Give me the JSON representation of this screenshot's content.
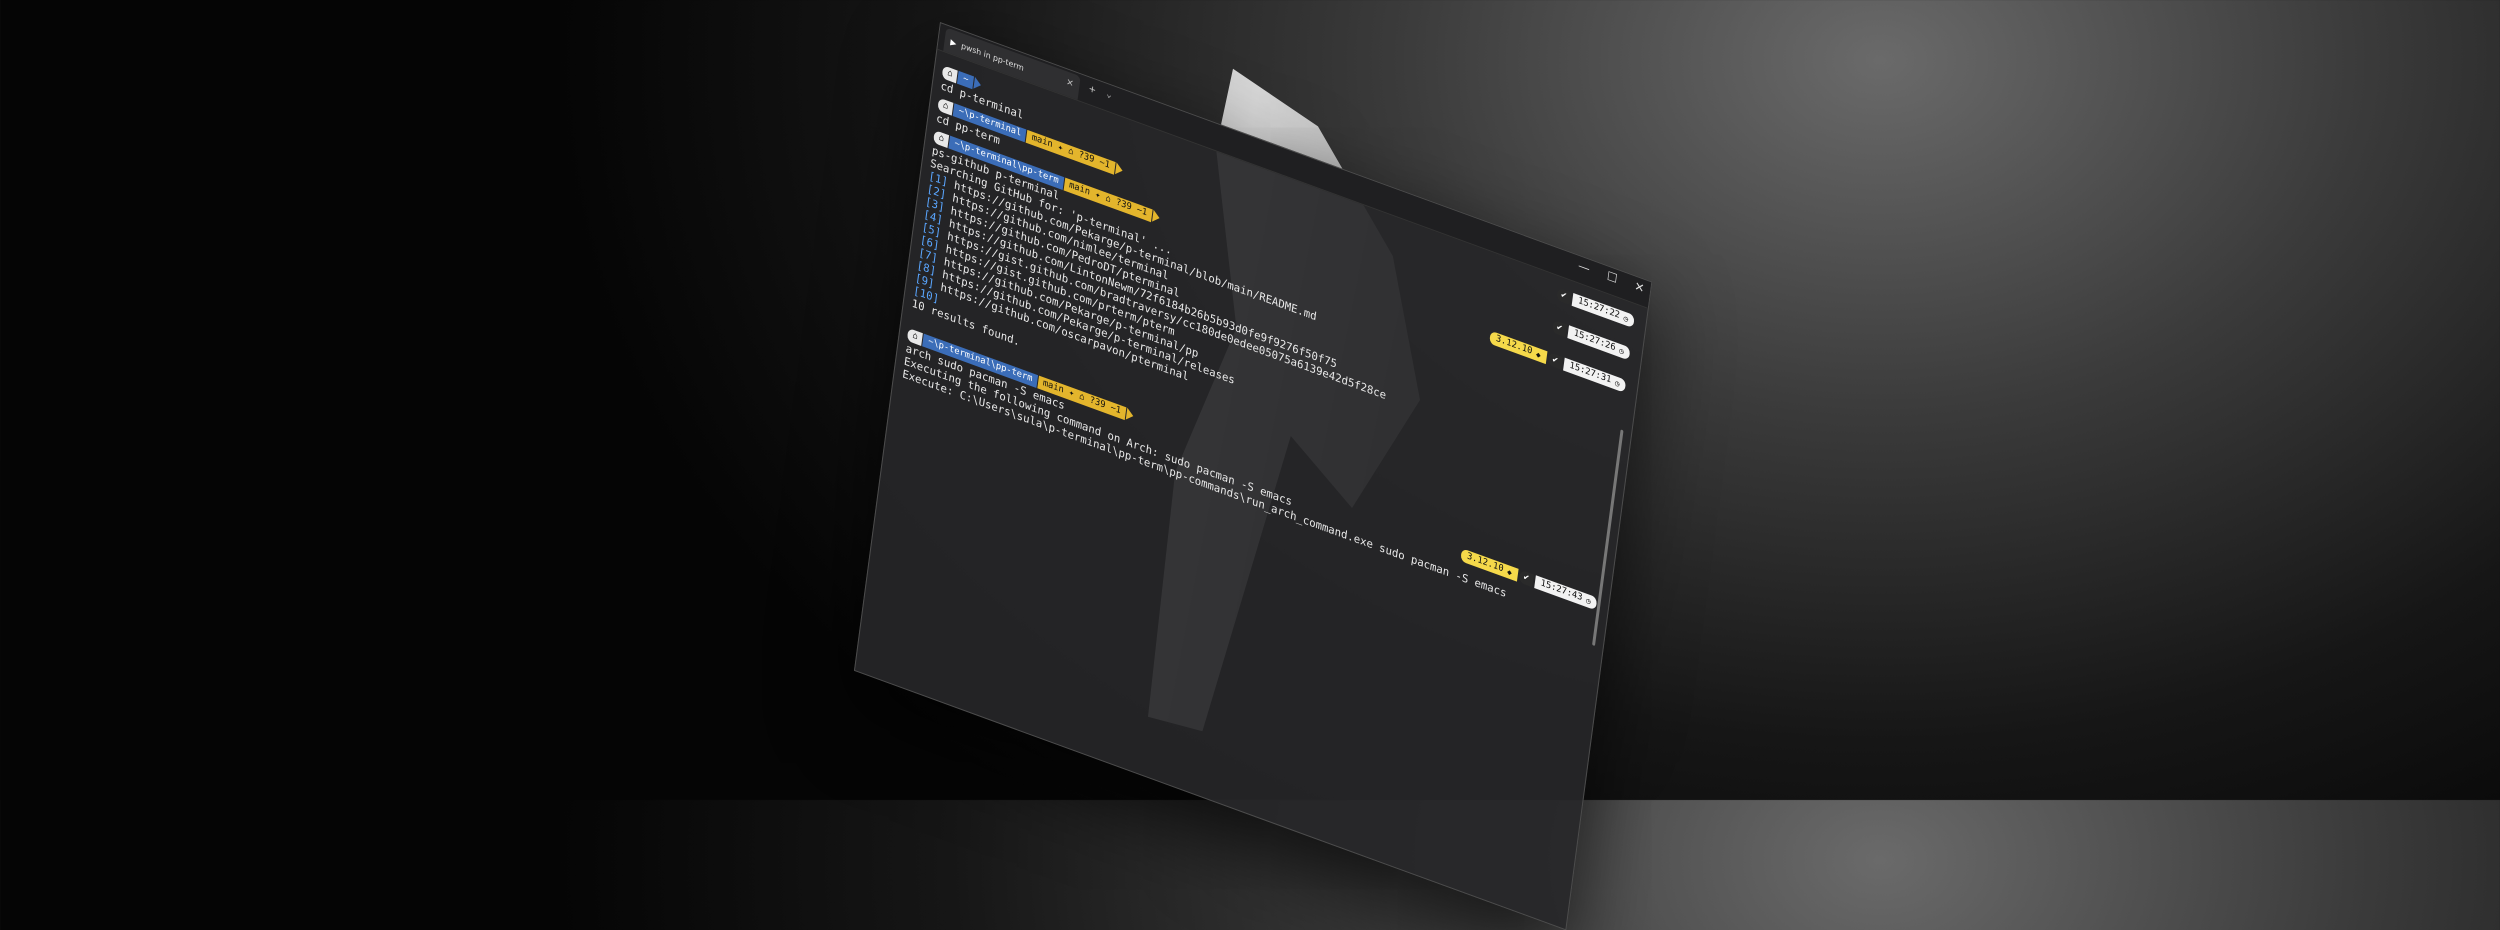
{
  "window": {
    "tab_title": "pwsh in pp-term",
    "tab_icon": "terminal-icon",
    "new_tab": "+",
    "dropdown": "⌄",
    "minimize": "—",
    "maximize": "☐",
    "close": "✕"
  },
  "prompt": {
    "os_icon": "arch-linux-icon",
    "git_branch": "main ✦ ⌂ ?39 ~1",
    "colors": {
      "os": "#e8e8e8",
      "dir": "#3b6db8",
      "git": "#e3b52c",
      "python": "#f5d94a"
    }
  },
  "session": {
    "p1_dir": "~",
    "cmd1": "cd p-terminal",
    "p2_dir": "~\\p-terminal",
    "cmd2": "cd pp-term",
    "p3_dir": "~\\p-terminal\\pp-term",
    "cmd3": "ps-github p-terminal",
    "search_msg": "Searching GitHub for: 'p-terminal' ...",
    "results": [
      {
        "idx": "[1]",
        "url": "https://github.com/Pekarge/p-terminal/blob/main/README.md"
      },
      {
        "idx": "[2]",
        "url": "https://github.com/nimlee/terminal"
      },
      {
        "idx": "[3]",
        "url": "https://github.com/PedroDT/pterminal"
      },
      {
        "idx": "[4]",
        "url": "https://github.com/LintonNewm/72f6184b26b5b93d0fe9f9276f50f75"
      },
      {
        "idx": "[5]",
        "url": "https://gist.github.com/bradtraversy/cc180de0edee05075a6139e42d5f28ce"
      },
      {
        "idx": "[6]",
        "url": "https://gist.github.com/prterm/pterm"
      },
      {
        "idx": "[7]",
        "url": "https://github.com/Pekarge/p-terminal/pp"
      },
      {
        "idx": "[8]",
        "url": "https://github.com/Pekarge/p-terminal/releases"
      },
      {
        "idx": "[9]",
        "url": "https://github.com/oscarpavon/pterminal"
      },
      {
        "idx": "[10]",
        "url": ""
      }
    ],
    "results_count": "10 results found.",
    "p4_dir": "~\\p-terminal\\pp-term",
    "cmd4": "arch sudo pacman -S emacs",
    "exec_msg": "Executing the following command on Arch: sudo pacman -S emacs",
    "exec_path": "Execute: C:\\Users\\sula\\p-terminal\\pp-term\\pp-commands\\run_arch_command.exe sudo pacman -S emacs"
  },
  "right_prompts": [
    {
      "python": "",
      "time": "15:27:22"
    },
    {
      "python": "",
      "time": "15:27:26"
    },
    {
      "python": "3.12.10",
      "time": "15:27:31"
    },
    {
      "python": "3.12.10",
      "time": "15:27:43"
    }
  ]
}
